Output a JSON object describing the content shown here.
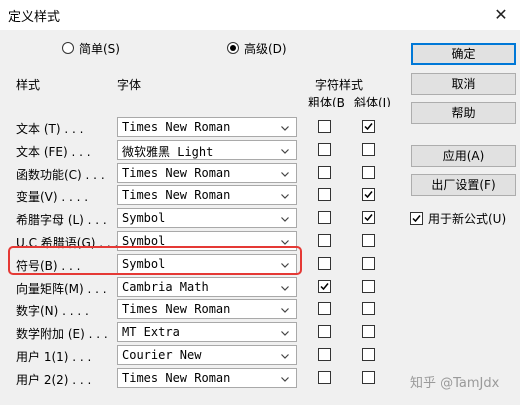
{
  "window": {
    "title": "定义样式",
    "close_glyph": "✕"
  },
  "mode": {
    "simple_label": "简单(S)",
    "advanced_label": "高级(D)",
    "selected": "advanced"
  },
  "headers": {
    "style": "样式",
    "font": "字体",
    "char_style": "字符样式",
    "bold": "粗体(B)",
    "italic": "斜体(I)"
  },
  "rows": [
    {
      "label": "文本 (T) . . .",
      "font": "Times New Roman",
      "bold": false,
      "italic": true
    },
    {
      "label": "文本 (FE) . . .",
      "font": "微软雅黑 Light",
      "bold": false,
      "italic": false
    },
    {
      "label": "函数功能(C) . . .",
      "font": "Times New Roman",
      "bold": false,
      "italic": false
    },
    {
      "label": "变量(V) . . . .",
      "font": "Times New Roman",
      "bold": false,
      "italic": true
    },
    {
      "label": "希腊字母 (L) . . .",
      "font": "Symbol",
      "bold": false,
      "italic": true
    },
    {
      "label": "U.C 希腊语(G) . . .",
      "font": "Symbol",
      "bold": false,
      "italic": false
    },
    {
      "label": "符号(B) . . .",
      "font": "Symbol",
      "bold": false,
      "italic": false
    },
    {
      "label": "向量矩阵(M) . . .",
      "font": "Cambria Math",
      "bold": true,
      "italic": false
    },
    {
      "label": "数字(N) . . . .",
      "font": "Times New Roman",
      "bold": false,
      "italic": false
    },
    {
      "label": "数学附加 (E) . . .",
      "font": "MT Extra",
      "bold": false,
      "italic": false
    },
    {
      "label": "用户 1(1) . . .",
      "font": "Courier New",
      "bold": false,
      "italic": false
    },
    {
      "label": "用户 2(2) . . .",
      "font": "Times New Roman",
      "bold": false,
      "italic": false
    }
  ],
  "buttons": {
    "ok": "确定",
    "cancel": "取消",
    "help": "帮助",
    "apply": "应用(A)",
    "factory": "出厂设置(F)"
  },
  "use_new_formula": {
    "label": "用于新公式(U)",
    "checked": true
  },
  "watermark": "知乎 @TamJdx",
  "colors": {
    "highlight": "#e53935",
    "default_button_border": "#0078d7"
  }
}
